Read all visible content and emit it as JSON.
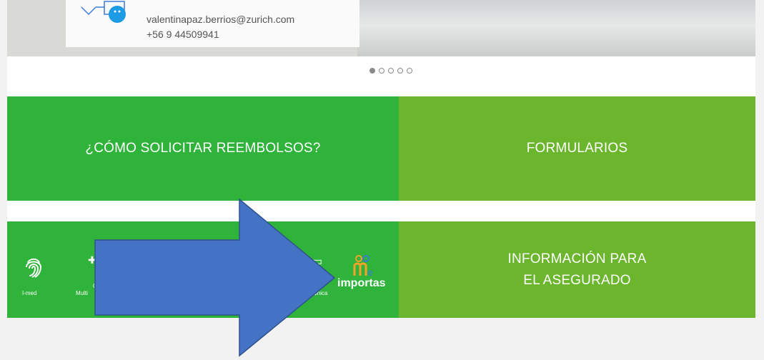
{
  "hero": {
    "contact_email": "valentinapaz.berrios@zurich.com",
    "contact_phone": "+56 9 44509941"
  },
  "carousel": {
    "dot_count": 5,
    "active_index": 0
  },
  "tiles": {
    "reembolsos": "¿CÓMO SOLICITAR REEMBOLSOS?",
    "formularios": "FORMULARIOS",
    "info_line1": "INFORMACIÓN PARA",
    "info_line2": "EL ASEGURADO"
  },
  "apps": {
    "imed": "I-med",
    "multi_1": "Co",
    "multi_2": "Multi",
    "unica": "Única",
    "me_importas": "importas"
  },
  "colors": {
    "green_dark": "#2fb33a",
    "green_light": "#6bb62d",
    "arrow_fill": "#4472c4",
    "arrow_stroke": "#2f528f"
  }
}
